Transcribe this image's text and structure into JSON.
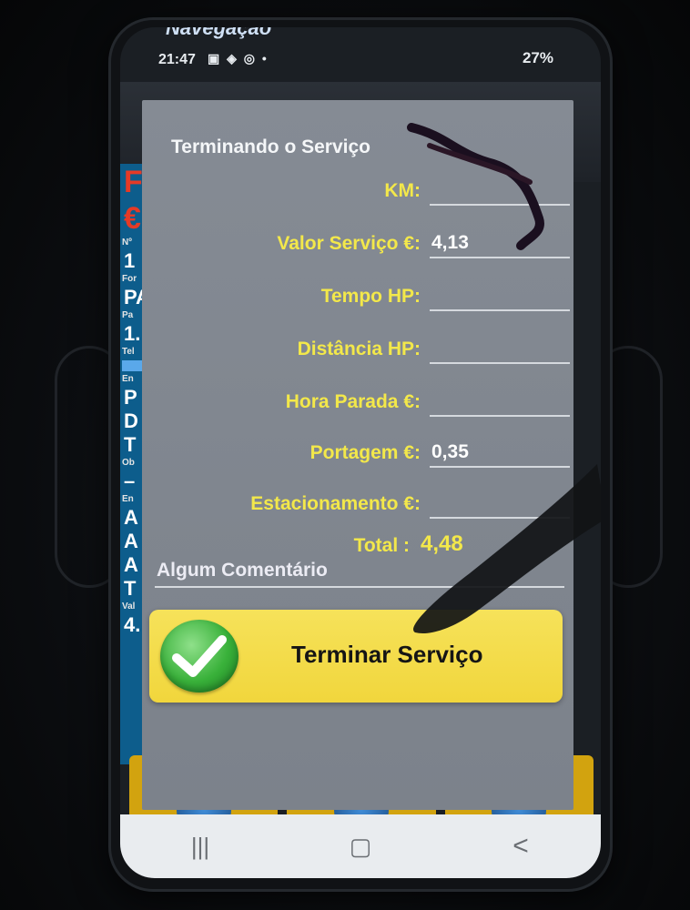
{
  "background_app": {
    "top_title": "Navegação",
    "left_column": [
      {
        "t": "F",
        "k": "red"
      },
      {
        "t": "€",
        "k": "red"
      },
      {
        "t": "Nº",
        "k": "s"
      },
      {
        "t": "1",
        "k": "r"
      },
      {
        "t": "For",
        "k": "s"
      },
      {
        "t": "PA",
        "k": "r"
      },
      {
        "t": "Pa",
        "k": "s"
      },
      {
        "t": "1.",
        "k": "r"
      },
      {
        "t": "Tel",
        "k": "s"
      },
      {
        "t": "",
        "k": "bar"
      },
      {
        "t": "En",
        "k": "s"
      },
      {
        "t": "P",
        "k": "r"
      },
      {
        "t": "D",
        "k": "r"
      },
      {
        "t": "T",
        "k": "r"
      },
      {
        "t": "Ob",
        "k": "s"
      },
      {
        "t": "–",
        "k": "r"
      },
      {
        "t": "En",
        "k": "s"
      },
      {
        "t": "A",
        "k": "r"
      },
      {
        "t": "A",
        "k": "r"
      },
      {
        "t": "A",
        "k": "r"
      },
      {
        "t": "T",
        "k": "r"
      },
      {
        "t": "Val",
        "k": "s"
      },
      {
        "t": "4.",
        "k": "r"
      }
    ]
  },
  "status_bar": {
    "time": "21:47",
    "icons": "▣ ◈ ◎ •",
    "battery": "27%"
  },
  "dialog": {
    "title": "Terminando o Serviço",
    "fields": {
      "km": {
        "label": "KM:",
        "value": ""
      },
      "valor_servico": {
        "label": "Valor Serviço €:",
        "value": "4,13"
      },
      "tempo_hp": {
        "label": "Tempo HP:",
        "value": ""
      },
      "distancia_hp": {
        "label": "Distância HP:",
        "value": ""
      },
      "hora_parada": {
        "label": "Hora Parada €:",
        "value": ""
      },
      "portagem": {
        "label": "Portagem €:",
        "value": "0,35"
      },
      "estacionamento": {
        "label": "Estacionamento €:",
        "value": ""
      }
    },
    "total": {
      "label": "Total :",
      "value": "4,48"
    },
    "comment_placeholder": "Algum Comentário",
    "finish_button_label": "Terminar Serviço"
  },
  "nav_bar": {
    "recents": "|||",
    "home": "▢",
    "back": "<"
  },
  "colors": {
    "dialog_bg": "#7f858e",
    "label_yellow": "#f3e84a",
    "button_yellow": "#f3da45",
    "check_green": "#39b13a"
  }
}
